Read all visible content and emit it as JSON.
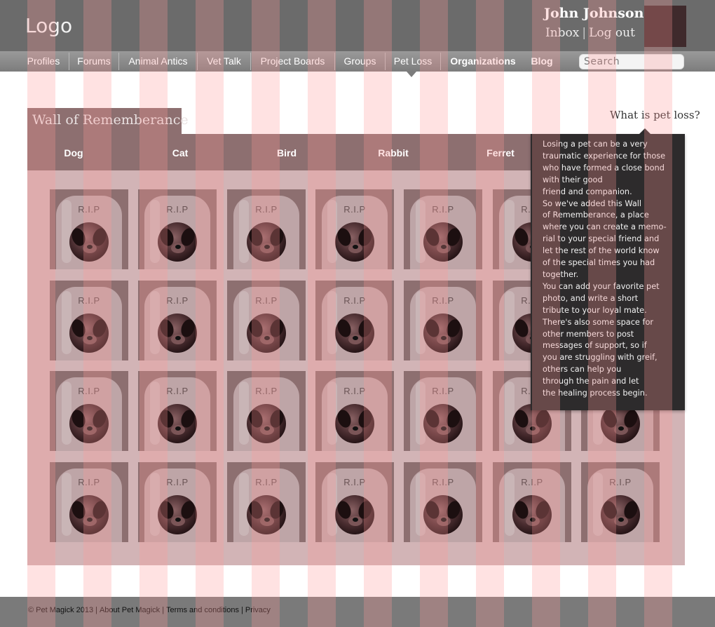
{
  "header": {
    "logo": "Logo",
    "user_name": "John Johnson",
    "inbox": "Inbox",
    "separator": "|",
    "logout": "Log out"
  },
  "nav": {
    "items": [
      "Profiles",
      "Forums",
      "Animal Antics",
      "Vet Talk",
      "Project Boards",
      "Groups",
      "Pet Loss",
      "Organizations",
      "Blog"
    ],
    "active": "Pet Loss",
    "search_placeholder": "Search"
  },
  "wall": {
    "title": "Wall of Rememberance",
    "what_link": "What is pet loss?",
    "categories": [
      "Dog",
      "Cat",
      "Bird",
      "Rabbit",
      "Ferret"
    ],
    "active_category": "Dog",
    "tile_label": "R.I.P",
    "rows": 4,
    "cols": 7
  },
  "popup": {
    "lines": [
      "Losing a pet can be a very",
      "traumatic experience for those",
      "who have formed a close bond",
      "with their good",
      "friend and companion.",
      "So we've added this Wall",
      "of Rememberance, a place",
      "where you can create a memo-",
      "rial to your special friend and",
      "let the rest of the world know",
      "of the special times you had",
      "together.",
      "You can add your favorite pet",
      "photo, and write a short",
      "tribute to your loyal mate.",
      "There's also some space for",
      "other members to post",
      "messages of support, so if",
      "you are struggling with greif,",
      "others can help you",
      "through the pain and let",
      "the healing process begin."
    ]
  },
  "footer": {
    "copyright": "© Pet Magick 2013",
    "about": "About Pet Magick",
    "terms": "Terms and conditions",
    "privacy": "Privacy",
    "separator": "|"
  },
  "colors": {
    "header_bg": "#6b6b6b",
    "panel_bg": "#d2b4b6",
    "tab_bg": "#8d6f70",
    "popup_bg": "#2d2b2c"
  }
}
